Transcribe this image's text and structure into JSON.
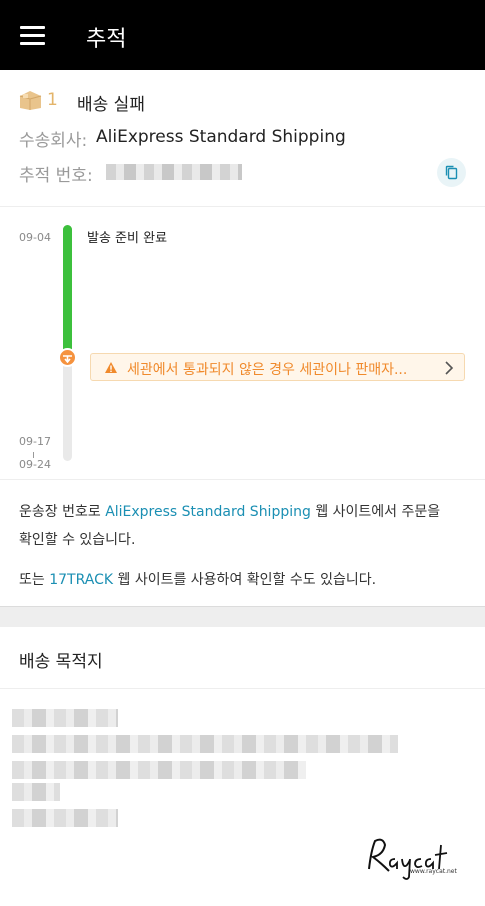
{
  "header": {
    "menu_icon": "hamburger-menu-icon",
    "title": "추적"
  },
  "shipment": {
    "package_icon": "package-box-icon",
    "count": "1",
    "status": "배송 실패",
    "carrier_label": "수송회사:",
    "carrier_name": "AliExpress Standard Shipping",
    "tracking_label": "추적 번호:",
    "copy_icon": "copy-icon"
  },
  "timeline": {
    "start_date": "09-04",
    "end_date_from": "09-17",
    "end_date_to": "09-24",
    "event_text": "발송 준비 완료",
    "alert_text": "세관에서 통과되지 않은 경우 세관이나 판매자...",
    "alert_icon": "warning-icon",
    "chevron_icon": "chevron-right-icon",
    "progress_color": "#3cc03c",
    "alert_color": "#f08a2c"
  },
  "info": {
    "line1_prefix": "운송장 번호로",
    "line1_link": "AliExpress Standard Shipping",
    "line1_suffix": "웹 사이트에서 주문을",
    "line2": "확인할 수 있습니다.",
    "line3_prefix": "또는",
    "line3_link": "17TRACK",
    "line3_suffix": "웹 사이트를 사용하여 확인할 수도 있습니다.",
    "link_color": "#1b8fb3"
  },
  "destination": {
    "title": "배송 목적지"
  },
  "watermark": {
    "brand": "Raycat",
    "url": "www.raycat.net"
  }
}
